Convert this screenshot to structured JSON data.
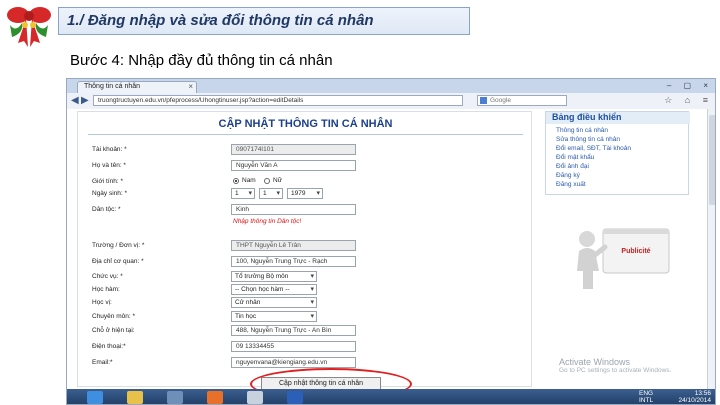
{
  "slide": {
    "title": "1./ Đăng nhập và sửa đổi thông tin cá nhân",
    "step": "Bước 4: Nhập đầy đủ thông tin cá nhân"
  },
  "browser": {
    "tab_label": "Thông tin cá nhân",
    "url": "truongtructuyen.edu.vn/pfeprocess/Uhongtinuser.jsp?action=editDetails",
    "search_placeholder": "Google"
  },
  "form": {
    "title": "CẬP NHẬT THÔNG TIN CÁ NHÂN",
    "fields": {
      "username": {
        "label": "Tài khoản: *",
        "value": "0907174Ι101"
      },
      "fullname": {
        "label": "Họ và tên: *",
        "value": "Nguyễn Văn A"
      },
      "gender": {
        "label": "Giới tính: *",
        "option_male": "Nam",
        "option_female": "Nữ"
      },
      "birthdate": {
        "label": "Ngày sinh: *",
        "day": "1",
        "month": "1",
        "year": "1979"
      },
      "ethnicity": {
        "label": "Dân tộc: *",
        "value": "Kinh",
        "error": "Nhập thông tin Dân tộc!"
      },
      "school": {
        "label": "Trường / Đơn vị: *",
        "value": "THPT Nguyễn Lê Trân"
      },
      "address": {
        "label": "Địa chỉ cơ quan: *",
        "value": "100, Nguyễn Trung Trực - Rạch"
      },
      "position": {
        "label": "Chức vụ: *",
        "value": "Tổ trưởng Bộ môn"
      },
      "rank": {
        "label": "Học hàm:",
        "value": "-- Chọn học hàm --"
      },
      "degree": {
        "label": "Học vị:",
        "value": "Cử nhân"
      },
      "major": {
        "label": "Chuyên môn: *",
        "value": "Tin học"
      },
      "residence": {
        "label": "Chỗ ở hiện tại:",
        "value": "488, Nguyễn Trung Trực - An Bìn"
      },
      "phone": {
        "label": "Điện thoại:*",
        "value": "09 13334455"
      },
      "email": {
        "label": "Email:*",
        "value": "nguyenvana@kiengiang.edu.vn"
      }
    },
    "submit_label": "Cập nhật thông tin cá nhân"
  },
  "sidebar": {
    "title": "Bảng điều khiển",
    "links": [
      "Thông tin cá nhân",
      "Sửa thông tin cá nhân",
      "Đổi email, SĐT, Tài khoản",
      "Đổi mật khẩu",
      "Đổi ảnh đại",
      "Đăng ký",
      "Đăng xuất"
    ]
  },
  "ad": {
    "text": "Publicité"
  },
  "watermark": {
    "line1": "Activate Windows",
    "line2": "Go to PC settings to activate Windows."
  },
  "taskbar": {
    "lang_top": "ENG",
    "lang_bottom": "INTL",
    "time": "13:56",
    "date": "24/10/2014"
  },
  "colors": {
    "accent": "#1d3f8f",
    "error": "#dd1111",
    "highlight_oval": "#e02020"
  }
}
